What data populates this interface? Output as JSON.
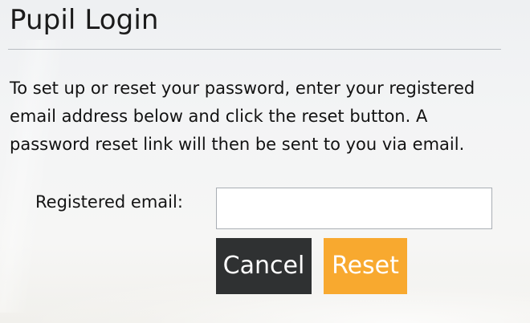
{
  "page": {
    "title": "Pupil Login"
  },
  "reset_form": {
    "instructions": "To set up or reset your password, enter your registered email address below and click the reset button. A password reset link will then be sent to you via email.",
    "email_label": "Registered email:",
    "email_value": "",
    "email_placeholder": "",
    "cancel_label": "Cancel",
    "reset_label": "Reset"
  },
  "colors": {
    "cancel_button": "#2f3132",
    "reset_button": "#f8a92f",
    "divider": "#b9bdc2"
  }
}
